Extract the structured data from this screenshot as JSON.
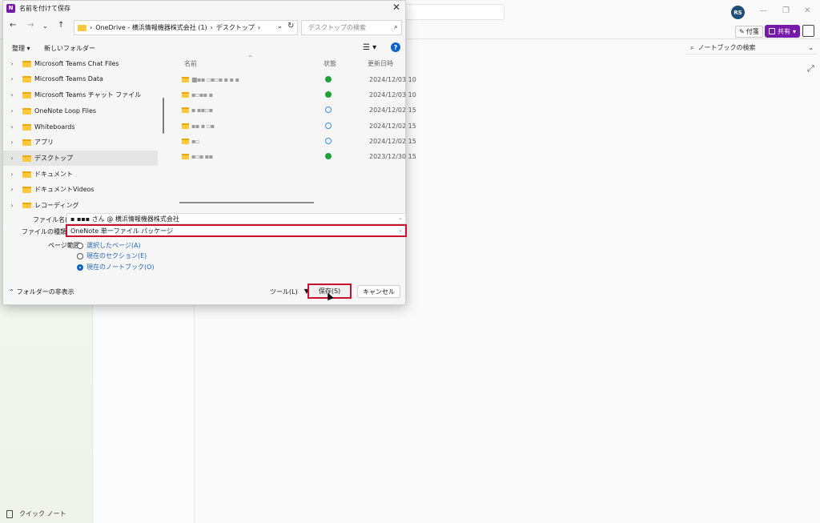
{
  "onenote": {
    "avatar_initials": "RS",
    "sticky_label": "付箋",
    "share_label": "共有",
    "notebook_search_placeholder": "ノートブックの検索",
    "quick_note_label": "クイック ノート",
    "accent": "#7719aa"
  },
  "dialog": {
    "title": "名前を付けて保存",
    "path": [
      "OneDrive - 横浜情報機器株式会社 (1)",
      "デスクトップ"
    ],
    "search_placeholder": "デスクトップの検索",
    "organize_label": "整理",
    "new_folder_label": "新しいフォルダー",
    "nav_items": [
      {
        "label": "Microsoft Teams Chat Files",
        "selected": false
      },
      {
        "label": "Microsoft Teams Data",
        "selected": false
      },
      {
        "label": "Microsoft Teams チャット ファイル",
        "selected": false
      },
      {
        "label": "OneNote Loop Files",
        "selected": false
      },
      {
        "label": "Whiteboards",
        "selected": false
      },
      {
        "label": "アプリ",
        "selected": false
      },
      {
        "label": "デスクトップ",
        "selected": true
      },
      {
        "label": "ドキュメント",
        "selected": false
      },
      {
        "label": "ドキュメントVideos",
        "selected": false
      },
      {
        "label": "レコーディング",
        "selected": false
      }
    ],
    "columns": {
      "name": "名前",
      "status": "状態",
      "modified": "更新日時"
    },
    "files": [
      {
        "name": "■▪▪ ▫▪▫▪ ▪ ▪ ▪",
        "status": "synced",
        "modified": "2024/12/03 10"
      },
      {
        "name": "▪▫▪▪ ▪",
        "status": "synced",
        "modified": "2024/12/03 10"
      },
      {
        "name": "▪ ▪▪▫▪",
        "status": "cloud",
        "modified": "2024/12/02 15"
      },
      {
        "name": "▪▪ ▪ ▫▪",
        "status": "cloud",
        "modified": "2024/12/02 15"
      },
      {
        "name": "▪▫",
        "status": "cloud",
        "modified": "2024/12/02 15"
      },
      {
        "name": "▪▫▪ ▪▪",
        "status": "synced",
        "modified": "2023/12/30 15"
      }
    ],
    "file_name_label": "ファイル名(N):",
    "file_name_value": "▪ ▪▪▪ さん @ 横浜情報機器株式会社",
    "file_type_label": "ファイルの種類(T):",
    "file_type_value": "OneNote 単一ファイル パッケージ",
    "page_range_label": "ページ範囲:",
    "range_options": [
      {
        "label": "選択したページ(A)",
        "checked": false
      },
      {
        "label": "現在のセクション(E)",
        "checked": false
      },
      {
        "label": "現在のノートブック(O)",
        "checked": true
      }
    ],
    "hide_folders_label": "フォルダーの非表示",
    "tools_label": "ツール(L)",
    "save_label": "保存(S)",
    "cancel_label": "キャンセル",
    "highlight_color": "#c8102e"
  }
}
